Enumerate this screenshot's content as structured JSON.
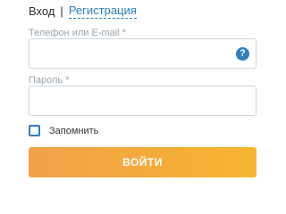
{
  "tabs": {
    "login": "Вход",
    "separator": "|",
    "register": "Регистрация"
  },
  "fields": {
    "phone_label": "Телефон или E-mail *",
    "phone_value": "",
    "help_icon": "?",
    "password_label": "Пароль *",
    "password_value": ""
  },
  "remember": {
    "label": "Запомнить",
    "checked": false
  },
  "submit": {
    "label": "ВОЙТИ"
  },
  "colors": {
    "accent": "#2d7db8",
    "button": "#f4ad3a",
    "label": "#9aa4ad"
  },
  "icons": {
    "help": "question-circle-icon",
    "checkbox": "checkbox-icon"
  }
}
